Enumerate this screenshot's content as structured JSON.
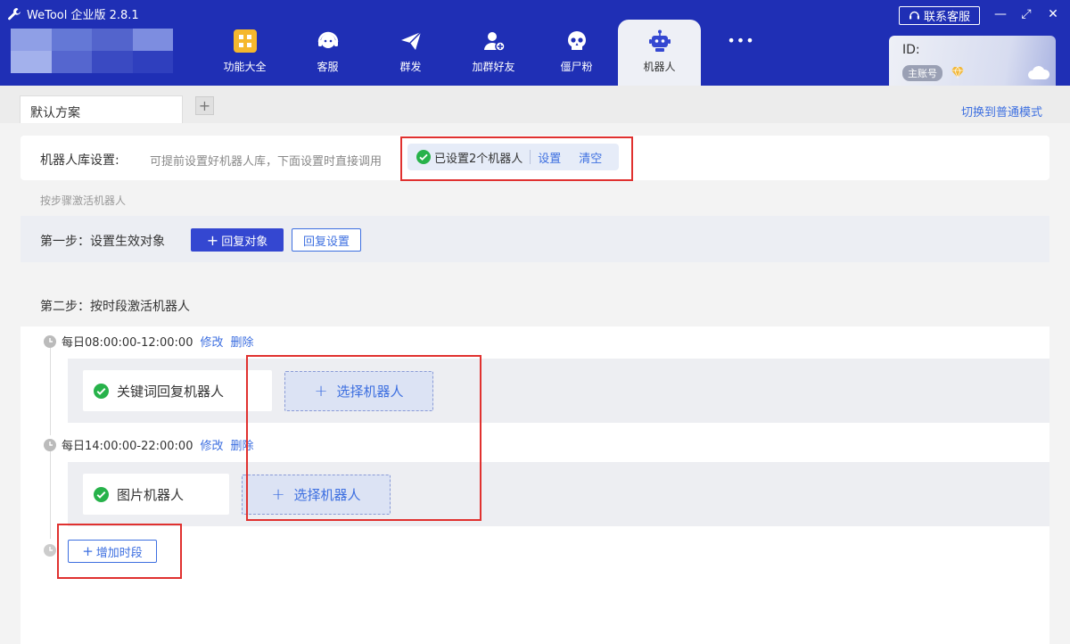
{
  "window": {
    "app_title": "WeTool 企业版 2.8.1",
    "contact_label": "联系客服",
    "minimize": "—",
    "maximize": "⤢",
    "close": "✕"
  },
  "nav": {
    "items": [
      {
        "label": "功能大全",
        "icon": "grid-icon"
      },
      {
        "label": "客服",
        "icon": "headset-icon"
      },
      {
        "label": "群发",
        "icon": "paper-plane-icon"
      },
      {
        "label": "加群好友",
        "icon": "add-friend-icon"
      },
      {
        "label": "僵尸粉",
        "icon": "skull-icon"
      },
      {
        "label": "机器人",
        "icon": "robot-icon",
        "active": true
      }
    ],
    "more": "•••"
  },
  "account": {
    "id_label": "ID:",
    "badge": "主账号"
  },
  "tabs": {
    "scheme": "默认方案",
    "add": "+",
    "switch_mode": "切换到普通模式"
  },
  "library": {
    "title": "机器人库设置:",
    "description": "可提前设置好机器人库，下面设置时直接调用",
    "status": "已设置2个机器人",
    "settings_link": "设置",
    "clear_link": "清空"
  },
  "steps": {
    "caption": "按步骤激活机器人",
    "step1_label": "第一步：设置生效对象",
    "reply_target_btn": "回复对象",
    "reply_settings_btn": "回复设置",
    "step2_label": "第二步：按时段激活机器人"
  },
  "periods": [
    {
      "time": "每日08:00:00-12:00:00",
      "edit": "修改",
      "delete": "删除",
      "bot": "关键词回复机器人",
      "select": "选择机器人"
    },
    {
      "time": "每日14:00:00-22:00:00",
      "edit": "修改",
      "delete": "删除",
      "bot": "图片机器人",
      "select": "选择机器人"
    }
  ],
  "add_period": "增加时段",
  "colors": {
    "header": "#1f2fb5",
    "primary": "#3447d1",
    "link": "#3d6fe0",
    "success": "#27b24a",
    "highlight_box": "#e0312f"
  }
}
